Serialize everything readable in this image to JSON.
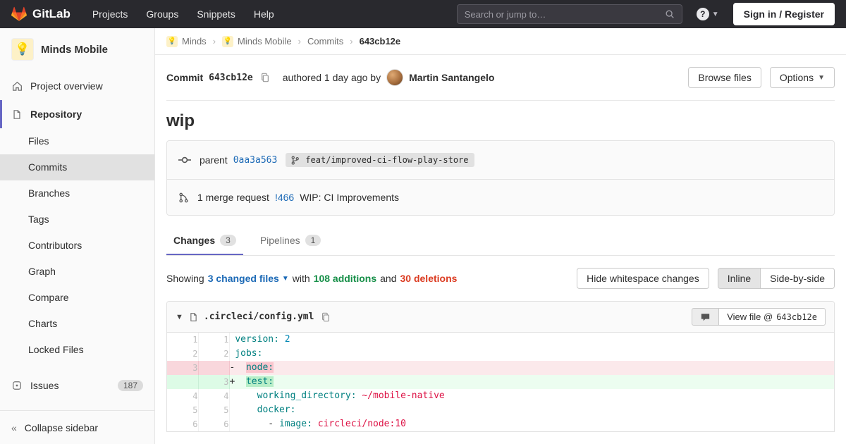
{
  "colors": {
    "accent": "#6666c4",
    "link": "#1b69b6",
    "addition": "#168f48",
    "deletion": "#db3b21",
    "brand_orange": "#fc6d26",
    "navbar_bg": "#29292e"
  },
  "navbar": {
    "brand": "GitLab",
    "menu": [
      "Projects",
      "Groups",
      "Snippets",
      "Help"
    ],
    "search_placeholder": "Search or jump to…",
    "sign_in": "Sign in / Register"
  },
  "sidebar": {
    "project_name": "Minds Mobile",
    "project_emoji": "💡",
    "project_overview": "Project overview",
    "repository": "Repository",
    "repo_subitems": [
      "Files",
      "Commits",
      "Branches",
      "Tags",
      "Contributors",
      "Graph",
      "Compare",
      "Charts",
      "Locked Files"
    ],
    "issues_label": "Issues",
    "issues_count": "187",
    "collapse_label": "Collapse sidebar"
  },
  "breadcrumb": {
    "items": [
      "Minds",
      "Minds Mobile",
      "Commits"
    ],
    "current": "643cb12e",
    "separator": "›",
    "avatar_emoji": "💡"
  },
  "commit": {
    "label": "Commit",
    "sha": "643cb12e",
    "authored": "authored 1 day ago by",
    "author": "Martin Santangelo",
    "browse_files": "Browse files",
    "options": "Options",
    "title": "wip",
    "parent_label": "parent",
    "parent_sha": "0aa3a563",
    "branch": "feat/improved-ci-flow-play-store",
    "mr_prefix": "1 merge request",
    "mr_ref": "!466",
    "mr_title": "WIP: CI Improvements"
  },
  "tabs": {
    "changes": "Changes",
    "changes_count": "3",
    "pipelines": "Pipelines",
    "pipelines_count": "1"
  },
  "summary": {
    "showing": "Showing",
    "files_link": "3 changed files",
    "with": "with",
    "additions": "108 additions",
    "and": "and",
    "deletions": "30 deletions",
    "hide_whitespace": "Hide whitespace changes",
    "inline": "Inline",
    "side_by_side": "Side-by-side"
  },
  "diff": {
    "filename": ".circleci/config.yml",
    "view_file_label": "View file @",
    "view_file_sha": "643cb12e",
    "lines": [
      {
        "old": "1",
        "new": "1",
        "type": "ctx",
        "sign": " ",
        "code": [
          [
            "version:",
            "k"
          ],
          [
            " ",
            ""
          ],
          [
            "2",
            "n"
          ]
        ]
      },
      {
        "old": "2",
        "new": "2",
        "type": "ctx",
        "sign": " ",
        "code": [
          [
            "jobs:",
            "k"
          ]
        ]
      },
      {
        "old": "3",
        "new": "",
        "type": "del",
        "sign": "-",
        "code": [
          [
            "  ",
            ""
          ],
          [
            "node:",
            "k hl"
          ]
        ]
      },
      {
        "old": "",
        "new": "3",
        "type": "add",
        "sign": "+",
        "code": [
          [
            "  ",
            ""
          ],
          [
            "test:",
            "k hl"
          ]
        ]
      },
      {
        "old": "4",
        "new": "4",
        "type": "ctx",
        "sign": " ",
        "code": [
          [
            "    ",
            ""
          ],
          [
            "working_directory:",
            "k"
          ],
          [
            " ",
            ""
          ],
          [
            "~/mobile-native",
            "s"
          ]
        ]
      },
      {
        "old": "5",
        "new": "5",
        "type": "ctx",
        "sign": " ",
        "code": [
          [
            "    ",
            ""
          ],
          [
            "docker:",
            "k"
          ]
        ]
      },
      {
        "old": "6",
        "new": "6",
        "type": "ctx",
        "sign": " ",
        "code": [
          [
            "      - ",
            ""
          ],
          [
            "image:",
            "k"
          ],
          [
            " ",
            ""
          ],
          [
            "circleci/node:10",
            "s"
          ]
        ]
      }
    ]
  }
}
